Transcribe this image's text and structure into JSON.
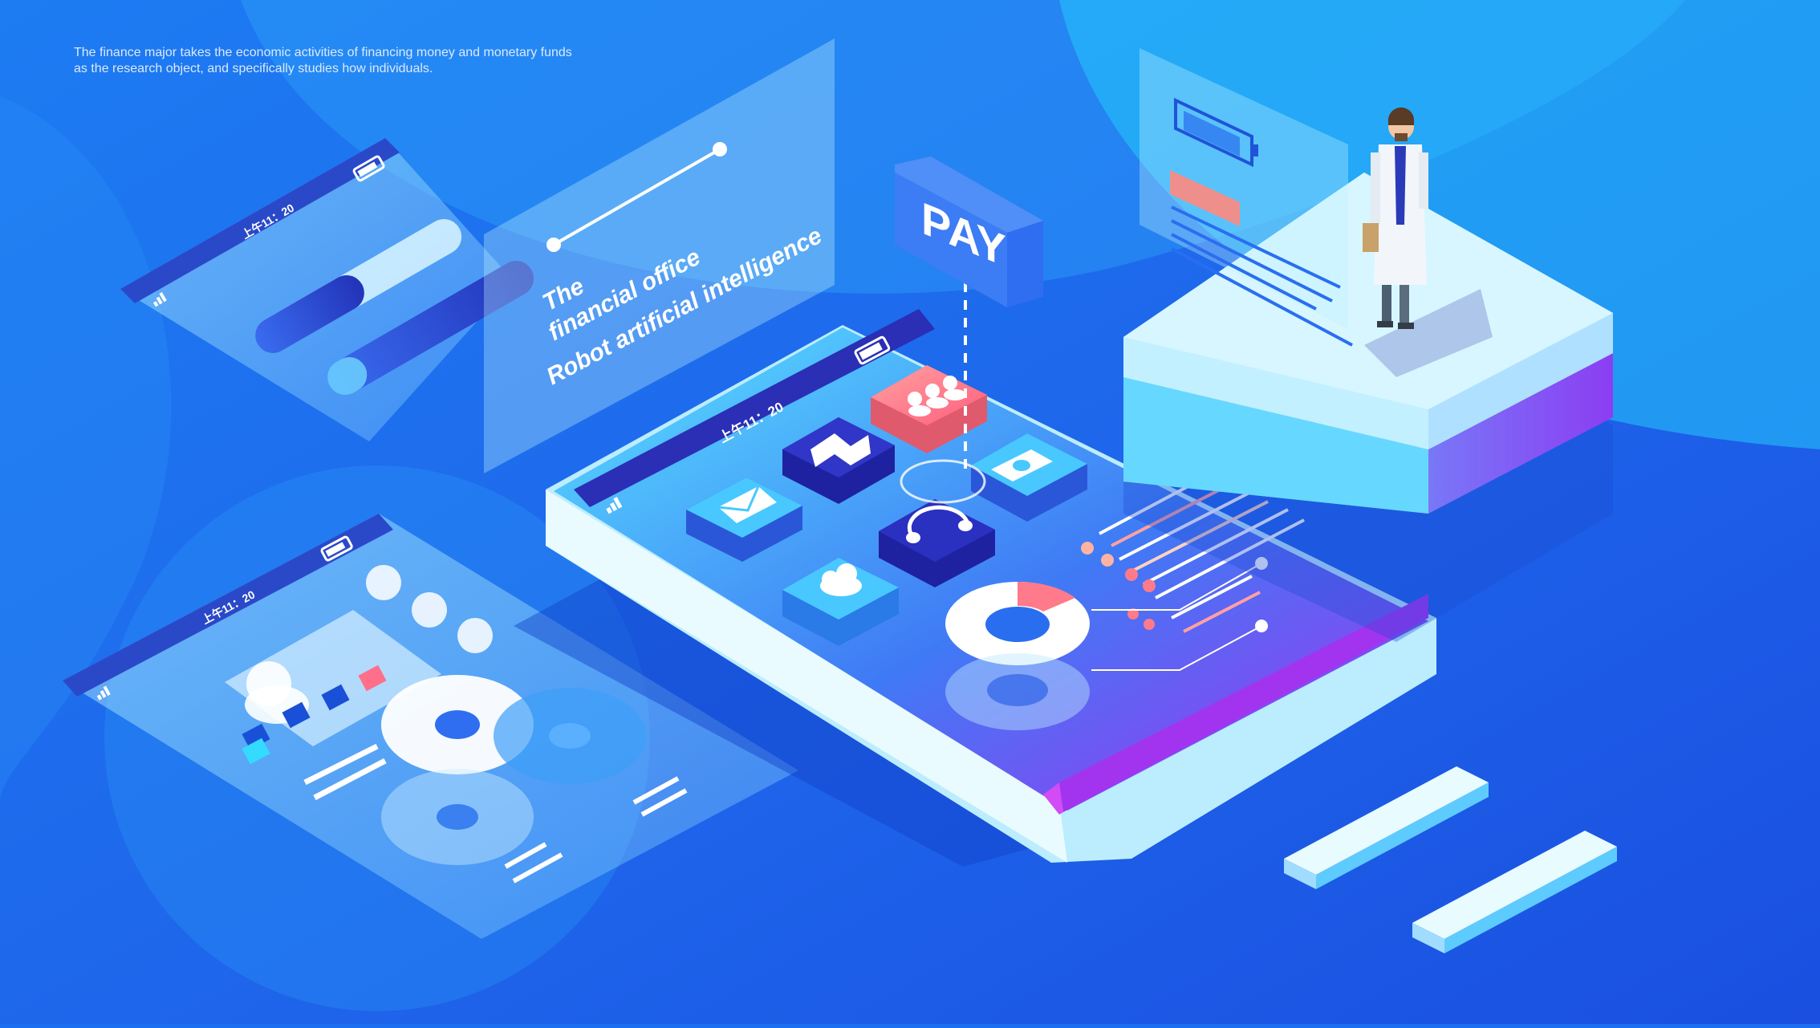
{
  "caption": {
    "line1": "The finance major takes the economic activities of financing money and monetary funds",
    "line2": "as the research object, and specifically studies how individuals."
  },
  "overlay_panel": {
    "line1": "The",
    "line2": "financial office",
    "line3": "Robot artificial intelligence"
  },
  "status_time": "上午11：20",
  "pay_sign": {
    "label": "PAY"
  },
  "colors": {
    "background": "#1b6ff0",
    "accent_pink": "#ff7a8a",
    "accent_purple": "#a234f0",
    "navy": "#2d2fb8",
    "glass": "#bfefff"
  },
  "icons": [
    "mail-icon",
    "map-icon",
    "people-icon",
    "headset-icon",
    "cloud-icon",
    "camera-icon",
    "battery-icon",
    "signal-icon",
    "person-icon"
  ]
}
